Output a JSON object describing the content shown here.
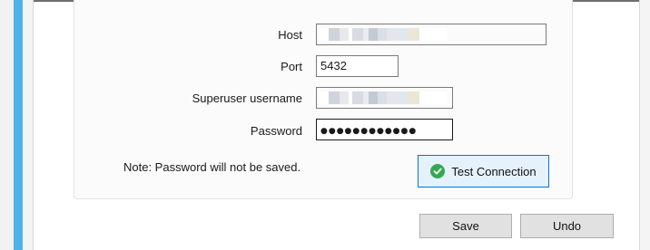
{
  "form": {
    "host": {
      "label": "Host",
      "value": ""
    },
    "port": {
      "label": "Port",
      "value": "5432"
    },
    "superuser": {
      "label": "Superuser username",
      "value": ""
    },
    "password": {
      "label": "Password",
      "value": "●●●●●●●●●●●●"
    },
    "note": "Note:  Password will not be saved.",
    "test_connection_label": "Test Connection"
  },
  "footer": {
    "save_label": "Save",
    "undo_label": "Undo"
  },
  "colors": {
    "accent": "#4fb2e6",
    "success": "#35a853",
    "focus": "#0078d7"
  },
  "icons": {
    "test_connection": "check-circle-icon"
  }
}
